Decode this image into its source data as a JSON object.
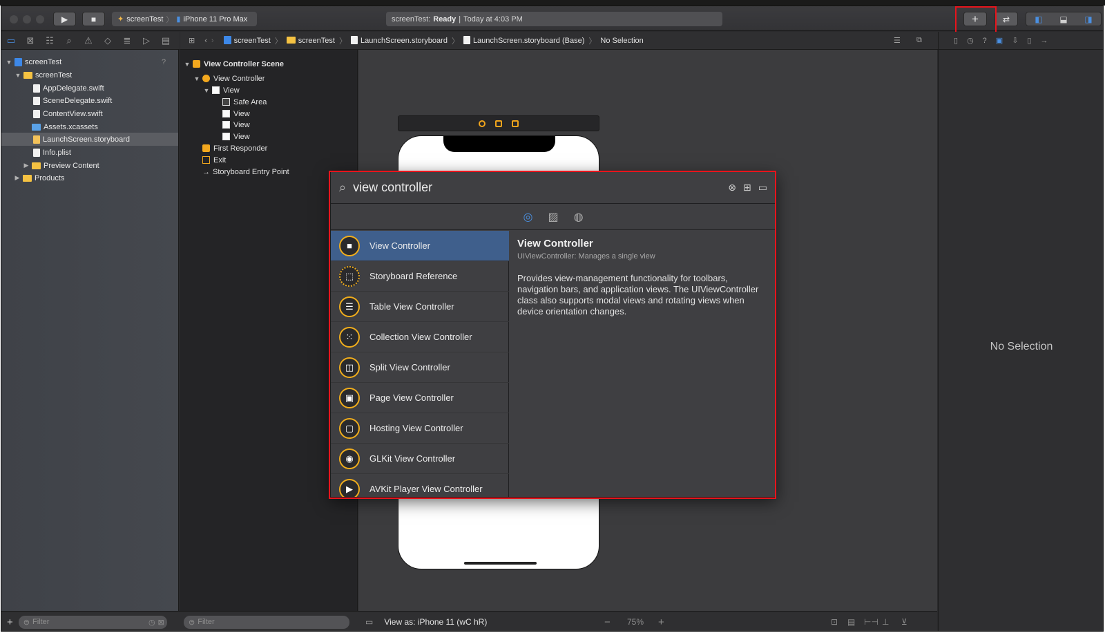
{
  "toolbar": {
    "scheme_target": "screenTest",
    "scheme_device": "iPhone 11 Pro Max",
    "status_project": "screenTest:",
    "status_state": "Ready",
    "status_time": "Today at 4:03 PM"
  },
  "jumpbar": {
    "items": [
      "screenTest",
      "screenTest",
      "LaunchScreen.storyboard",
      "LaunchScreen.storyboard (Base)",
      "No Selection"
    ]
  },
  "navigator": {
    "badge": "?",
    "items": [
      {
        "label": "screenTest"
      },
      {
        "label": "screenTest"
      },
      {
        "label": "AppDelegate.swift"
      },
      {
        "label": "SceneDelegate.swift"
      },
      {
        "label": "ContentView.swift"
      },
      {
        "label": "Assets.xcassets"
      },
      {
        "label": "LaunchScreen.storyboard"
      },
      {
        "label": "Info.plist"
      },
      {
        "label": "Preview Content"
      },
      {
        "label": "Products"
      }
    ],
    "filter_placeholder": "Filter"
  },
  "outline": {
    "items": [
      {
        "label": "View Controller Scene"
      },
      {
        "label": "View Controller"
      },
      {
        "label": "View"
      },
      {
        "label": "Safe Area"
      },
      {
        "label": "View"
      },
      {
        "label": "View"
      },
      {
        "label": "View"
      },
      {
        "label": "First Responder"
      },
      {
        "label": "Exit"
      },
      {
        "label": "Storyboard Entry Point"
      }
    ],
    "filter_placeholder": "Filter"
  },
  "canvas": {
    "view_as": "View as: iPhone 11 (",
    "view_as_size": "wC hR)",
    "zoom": "75%"
  },
  "inspector": {
    "no_selection": "No Selection"
  },
  "library": {
    "search_value": "view controller",
    "items": [
      {
        "label": "View Controller"
      },
      {
        "label": "Storyboard Reference"
      },
      {
        "label": "Table View Controller"
      },
      {
        "label": "Collection View Controller"
      },
      {
        "label": "Split View Controller"
      },
      {
        "label": "Page View Controller"
      },
      {
        "label": "Hosting View Controller"
      },
      {
        "label": "GLKit View Controller"
      },
      {
        "label": "AVKit Player View Controller"
      }
    ],
    "detail": {
      "title": "View Controller",
      "subtitle": "UIViewController: Manages a single view",
      "description": "Provides view-management functionality for toolbars, navigation bars, and application views. The UIViewController class also supports modal views and rotating views when device orientation changes."
    }
  },
  "colors": {
    "accent": "#3f5f8c",
    "highlight_box": "#e8141c",
    "library_icon": "#f0ad1c"
  },
  "icons": [
    "run-icon",
    "stop-icon",
    "plus-icon",
    "swap-arrows-icon",
    "search-icon",
    "clear-icon",
    "grid-icon",
    "list-icon",
    "objects-icon",
    "image-icon",
    "palette-icon"
  ]
}
